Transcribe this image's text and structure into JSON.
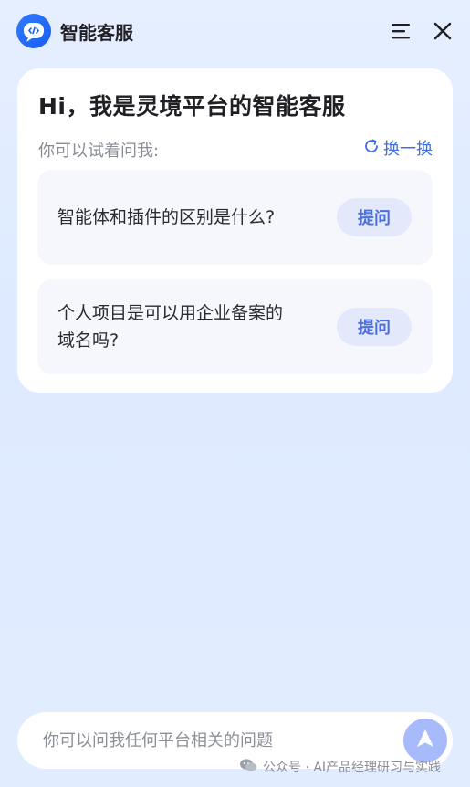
{
  "header": {
    "title": "智能客服",
    "logo_icon": "code-chat-icon",
    "menu_icon": "menu-lines-icon",
    "close_icon": "close-icon"
  },
  "welcome": {
    "greeting": "Hi，我是灵境平台的智能客服",
    "subtitle": "你可以试着问我:",
    "refresh_label": "换一换"
  },
  "suggestions": [
    {
      "question": "智能体和插件的区别是什么?",
      "button": "提问"
    },
    {
      "question_line1": "个人项目是可以用企业备案的",
      "question_line2": "域名吗?",
      "button": "提问"
    }
  ],
  "input": {
    "placeholder": "你可以问我任何平台相关的问题",
    "send_icon": "send-arrow-icon"
  },
  "watermark": {
    "text": "公众号 · AI产品经理研习与实践",
    "icon": "wechat-icon"
  },
  "colors": {
    "accent": "#3e6fe6",
    "button_text": "#4b6fe0",
    "button_bg": "#e3e9fb",
    "send_bg": "#a7bafc"
  }
}
